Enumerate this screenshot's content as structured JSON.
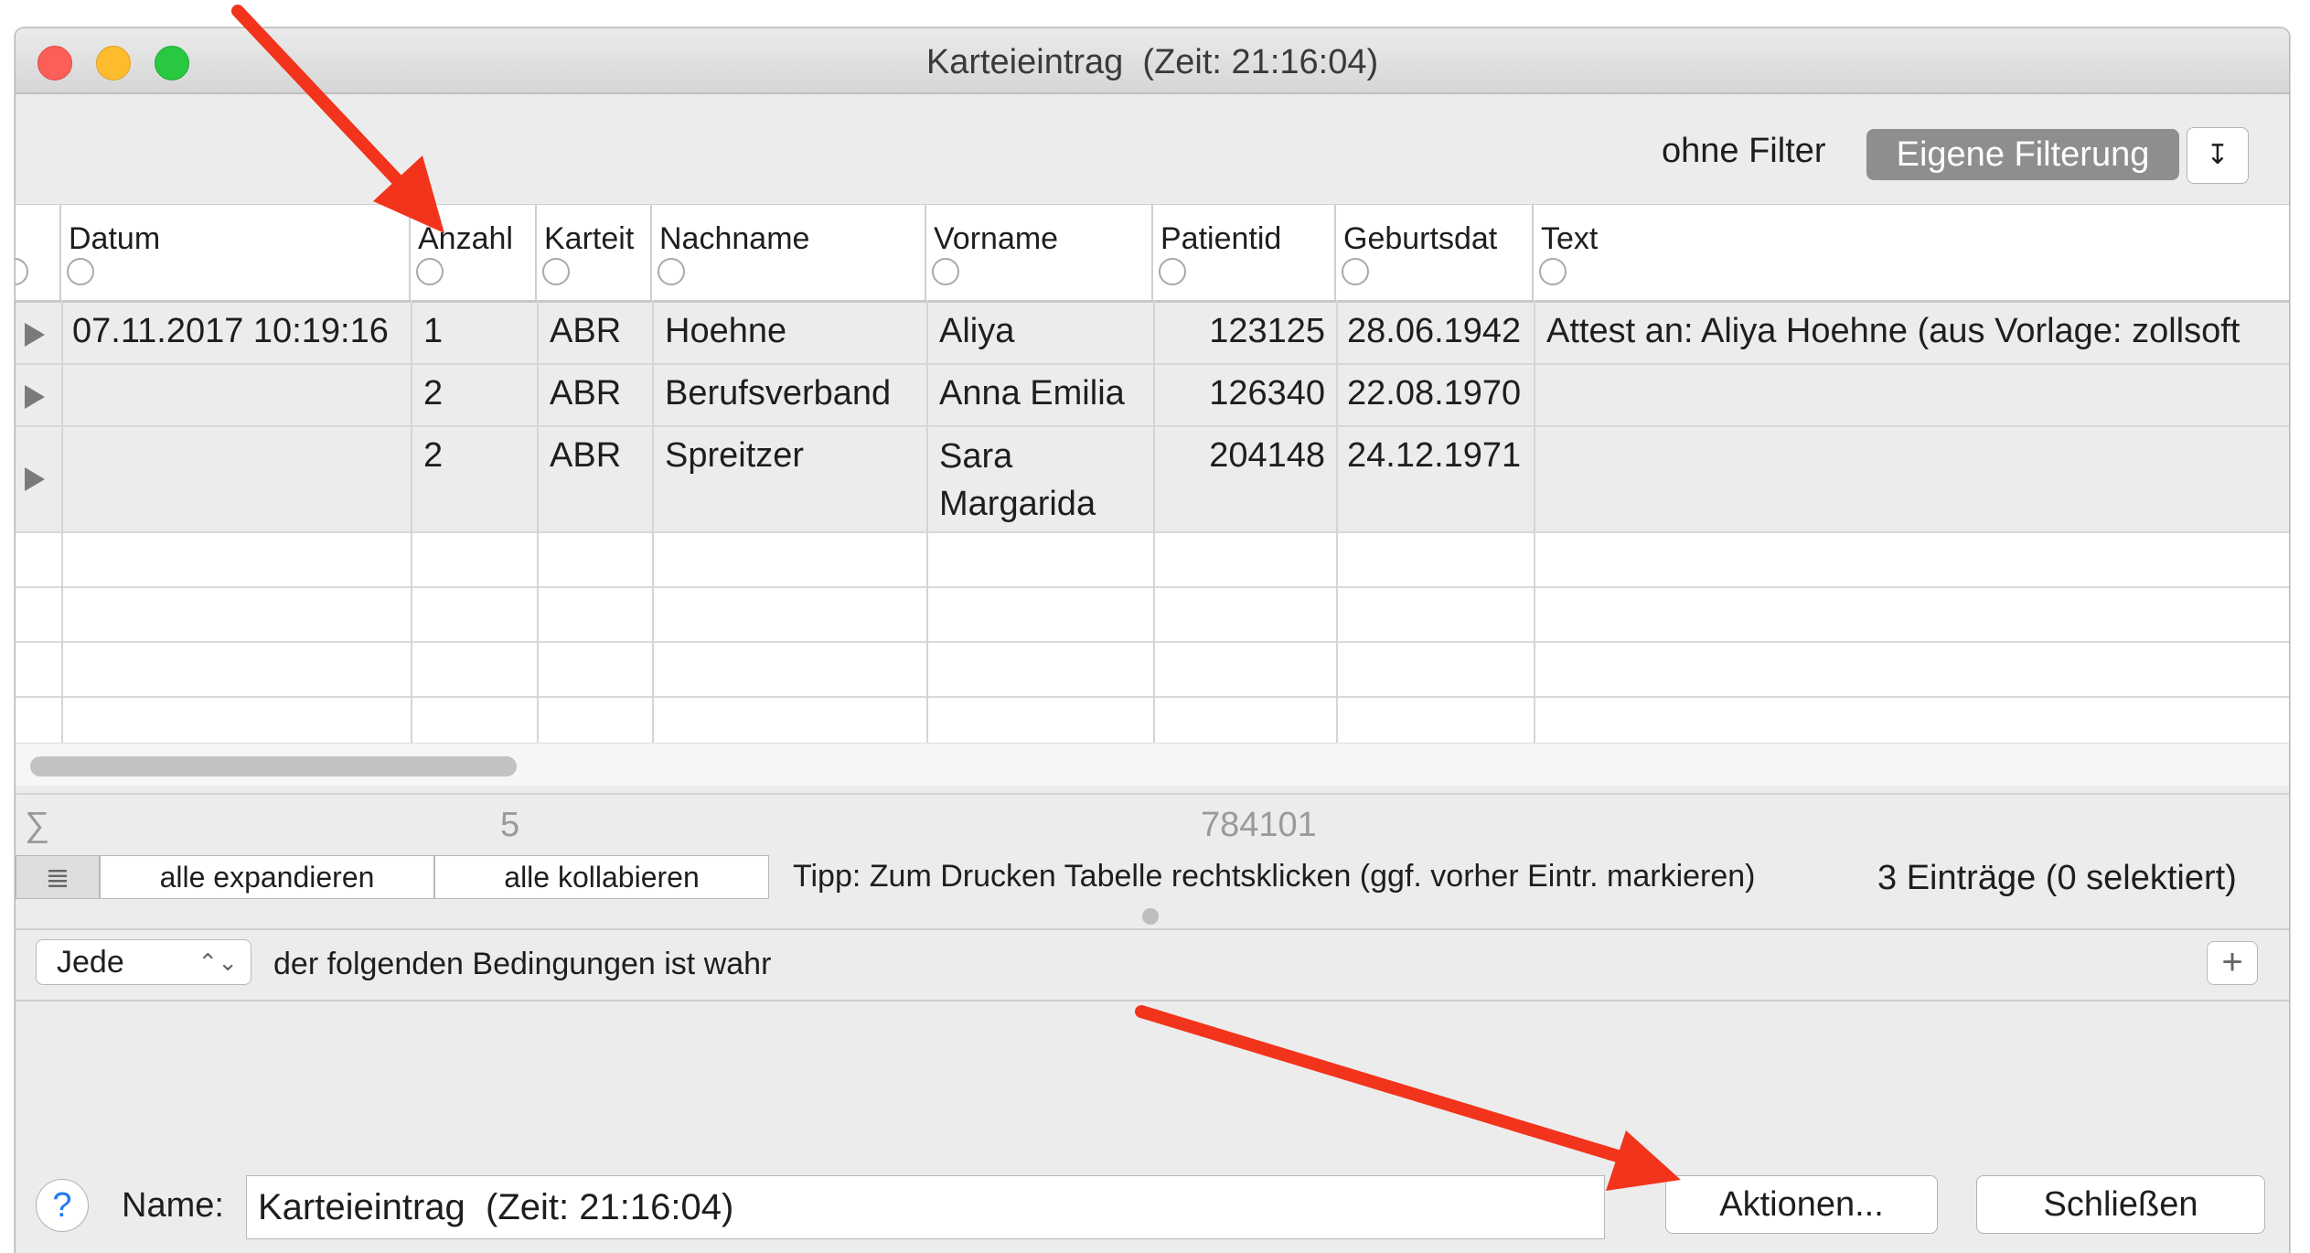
{
  "window": {
    "title": "Karteieintrag  (Zeit: 21:16:04)",
    "traffic_lights": {
      "close": "#fc5f57",
      "minimize": "#fdbc2e",
      "zoom": "#28c840"
    }
  },
  "filter": {
    "label": "ohne Filter",
    "selected": "Eigene Filterung",
    "menu_icon": "filter-menu-icon",
    "menu_glyph": "↧"
  },
  "table": {
    "columns": [
      "Datum",
      "Anzahl",
      "Karteit",
      "Nachname",
      "Vorname",
      "Patientid",
      "Geburtsdat",
      "Text"
    ],
    "rows": [
      {
        "datum": "07.11.2017 10:19:16",
        "anzahl": "1",
        "karteit": "ABR",
        "nachname": "Hoehne",
        "vorname": "Aliya",
        "patientid": "123125",
        "geburtsdat": "28.06.1942",
        "text": "Attest an: Aliya Hoehne (aus Vorlage: zollsoft"
      },
      {
        "datum": "",
        "anzahl": "2",
        "karteit": "ABR",
        "nachname": "Berufsverband",
        "vorname": "Anna Emilia",
        "patientid": "126340",
        "geburtsdat": "22.08.1970",
        "text": ""
      },
      {
        "datum": "",
        "anzahl": "2",
        "karteit": "ABR",
        "nachname": "Spreitzer",
        "vorname": "Sara\nMargarida",
        "patientid": "204148",
        "geburtsdat": "24.12.1971",
        "text": ""
      }
    ]
  },
  "summary": {
    "sigma": "∑",
    "anzahl_total": "5",
    "patientid_total": "784101"
  },
  "toolbar": {
    "list_icon": "list-icon",
    "list_glyph": "≣",
    "expand_all": "alle expandieren",
    "collapse_all": "alle kollabieren",
    "tip": "Tipp: Zum Drucken Tabelle rechtsklicken (ggf. vorher Eintr. markieren)",
    "entries": "3 Einträge (0 selektiert)"
  },
  "conditions": {
    "match": "Jede",
    "stepper_glyph": "⌃⌄",
    "text": "der folgenden Bedingungen ist wahr",
    "add_glyph": "+"
  },
  "footer": {
    "help": "?",
    "name_label": "Name:",
    "name_value": "Karteieintrag  (Zeit: 21:16:04)",
    "actions": "Aktionen...",
    "close": "Schließen"
  },
  "annotation_color": "#f2341c"
}
